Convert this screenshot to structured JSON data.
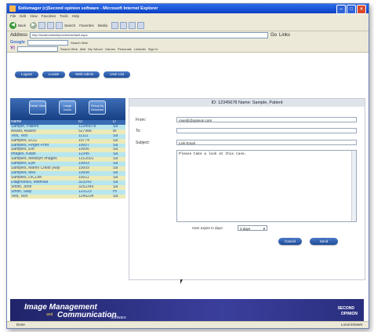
{
  "window": {
    "title": "Solismager (c)Second opinion software - Microsoft Internet Explorer"
  },
  "menu": [
    "File",
    "Edit",
    "View",
    "Favorites",
    "Tools",
    "Help"
  ],
  "toolbar": {
    "back_label": "Back",
    "search_label": "Search",
    "favorites_label": "Favorites",
    "media_label": "Media"
  },
  "address": {
    "label": "Address",
    "value": "http://localhost/webpreview/default.aspx",
    "go_label": "Go",
    "links_label": "Links"
  },
  "google": {
    "brand": "Google",
    "search_web": "Search Web"
  },
  "yahoo": {
    "brand": "Y!",
    "search_web": "Search Web",
    "mail": "Mail",
    "my_yahoo": "My Yahoo!",
    "games": "Games",
    "personals": "Personals",
    "linkedin": "LinkedIn",
    "sign_in": "Sign In"
  },
  "nav": {
    "logout": "Logout",
    "locate": "Locate",
    "web_admin": "Web Admin",
    "user_list": "User List"
  },
  "left": {
    "btn_detail": "Detail View",
    "btn_large": "Large Icons",
    "btn_group": "Group by Sessions",
    "headers": [
      "Name",
      "ID",
      "D"
    ],
    "rows": [
      [
        "Sample, Patient",
        "12345678",
        "Sa"
      ],
      [
        "Alsaro, Alasno",
        "527988",
        "Bl"
      ],
      [
        "Test, Test",
        "11111",
        "Sa"
      ],
      [
        "Samples, ECG",
        "10774",
        "Sa"
      ],
      [
        "Samples, Finger Print",
        "10007",
        "Sa"
      ],
      [
        "Samples, Ent",
        "10006",
        "Sa"
      ],
      [
        "Images, Kikan",
        "12345",
        "Sa"
      ],
      [
        "Samples, Medisyn Images",
        "1312001",
        "Sa"
      ],
      [
        "Samples, Eye",
        "10003",
        "Sa"
      ],
      [
        "Samples, Mamo Chest (Ray",
        "10009",
        "Sa"
      ],
      [
        "Samples, MRI",
        "10008",
        "Sa"
      ],
      [
        "Samples, DICOM",
        "10011",
        "Sa"
      ],
      [
        "Diagnostics, Midmals",
        "323243",
        "Sa"
      ],
      [
        "Smith, John",
        "3252345",
        "Sa"
      ],
      [
        "Smith, Sally",
        "123123",
        "Hi"
      ],
      [
        "Test, Test",
        "1245234",
        "Sa"
      ]
    ]
  },
  "form": {
    "header": "ID: 12345678 Name: Sample, Patient",
    "from_label": "From:",
    "from_value": "rose@@opinion.com",
    "to_label": "To:",
    "to_value": "",
    "subject_label": "Subject:",
    "subject_value": "Link Email",
    "body": "Please take a look at this case.",
    "expiry_label": "User expire in days:",
    "expiry_value": "3 days",
    "cancel": "Cancel",
    "send": "Send"
  },
  "footer": {
    "line1": "Image Management",
    "and": "and",
    "line2": "Communication",
    "software": "Software",
    "brand1": "SECOND",
    "brand2": "OPINION"
  },
  "status": {
    "left": "Done",
    "right": "Local intranet"
  },
  "colors": {
    "accent": "#1f4d9a",
    "row_a": "#b8e6ee",
    "row_b": "#eceab8",
    "footer": "#2a2e7e"
  }
}
